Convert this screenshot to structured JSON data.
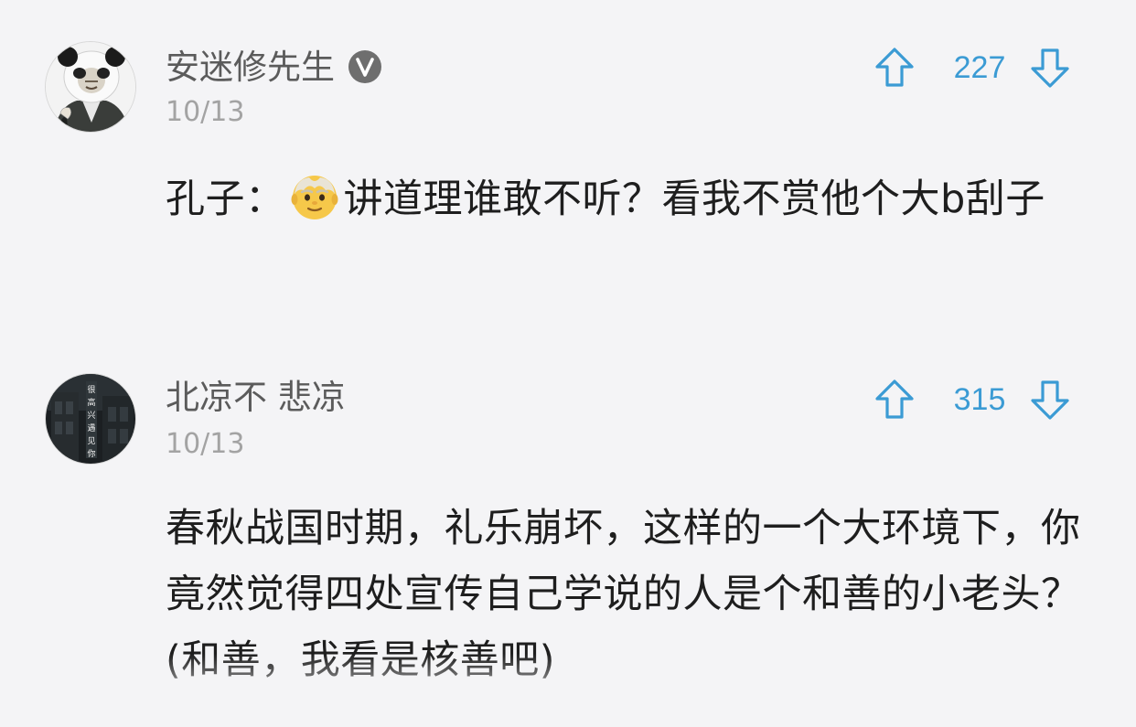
{
  "comments": [
    {
      "username": "安迷修先生",
      "verified": true,
      "date": "10/13",
      "votes": "227",
      "text_before_emoji": "孔子：",
      "emoji": "older-man-emoji",
      "text_after_emoji": "讲道理谁敢不听？看我不赏他个大b刮子",
      "avatar_icon": "panda-meme-avatar"
    },
    {
      "username": "北凉不 悲凉",
      "verified": false,
      "date": "10/13",
      "votes": "315",
      "text": "春秋战国时期，礼乐崩坏，这样的一个大环境下，你竟然觉得四处宣传自己学说的人是个和善的小老头？(和善，我看是核善吧)",
      "avatar_icon": "night-building-avatar",
      "avatar_lettering": "很高兴遇见你"
    }
  ],
  "icons": {
    "upvote": "arrow-up-outline-icon",
    "downvote": "arrow-down-outline-icon",
    "verified": "verified-v-badge-icon"
  },
  "colors": {
    "background": "#f4f4f6",
    "vote_accent": "#3b9bd4",
    "username": "#5b5b5b",
    "date": "#a3a3a3",
    "text": "#1e1e1e"
  }
}
